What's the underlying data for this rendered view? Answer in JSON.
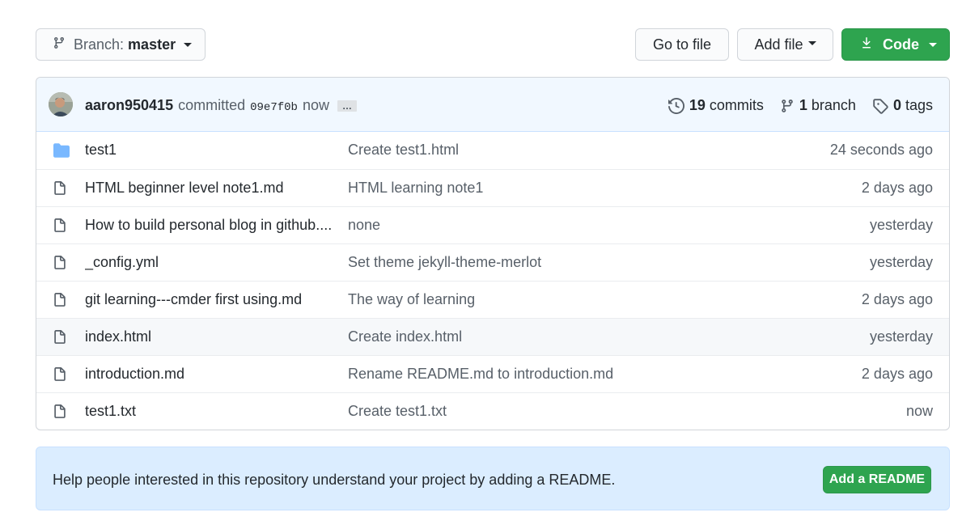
{
  "toolbar": {
    "branch_label": "Branch:",
    "branch_value": "master",
    "goto_label": "Go to file",
    "addfile_label": "Add file",
    "code_label": "Code"
  },
  "commit": {
    "author": "aaron950415",
    "verb": "committed",
    "sha": "09e7f0b",
    "time": "now",
    "ellipsis": "…"
  },
  "stats": {
    "commits_count": "19",
    "commits_label": "commits",
    "branch_count": "1",
    "branch_label": "branch",
    "tags_count": "0",
    "tags_label": "tags"
  },
  "files": [
    {
      "type": "folder",
      "name": "test1",
      "message": "Create test1.html",
      "age": "24 seconds ago"
    },
    {
      "type": "file",
      "name": "HTML beginner level note1.md",
      "message": "HTML learning note1",
      "age": "2 days ago"
    },
    {
      "type": "file",
      "name": "How to build personal blog in github....",
      "message": "none",
      "age": "yesterday"
    },
    {
      "type": "file",
      "name": "_config.yml",
      "message": "Set theme jekyll-theme-merlot",
      "age": "yesterday"
    },
    {
      "type": "file",
      "name": "git learning---cmder first using.md",
      "message": "The way of learning",
      "age": "2 days ago"
    },
    {
      "type": "file",
      "name": "index.html",
      "message": "Create index.html",
      "age": "yesterday"
    },
    {
      "type": "file",
      "name": "introduction.md",
      "message": "Rename README.md to introduction.md",
      "age": "2 days ago"
    },
    {
      "type": "file",
      "name": "test1.txt",
      "message": "Create test1.txt",
      "age": "now"
    }
  ],
  "readme_banner": {
    "message": "Help people interested in this repository understand your project by adding a README.",
    "button_label": "Add a README"
  },
  "icons": {
    "branch": "git-branch-icon",
    "download": "download-icon",
    "history": "history-icon",
    "tag": "tag-icon",
    "folder": "folder-icon",
    "file": "file-icon"
  },
  "colors": {
    "primary_green": "#2ea44f",
    "folder_blue": "#79b8ff",
    "header_bg": "#f1f8ff",
    "banner_bg": "#dbedff"
  }
}
